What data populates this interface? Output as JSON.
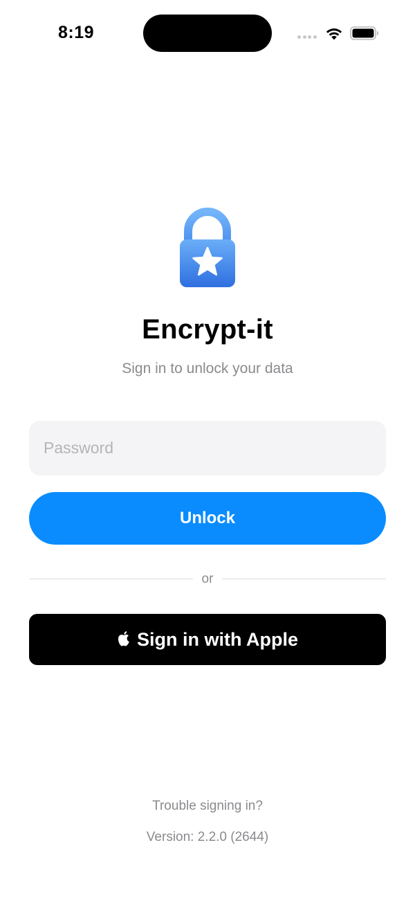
{
  "status_bar": {
    "time": "8:19"
  },
  "icons": {
    "app": "lock-star-icon",
    "signal": "cellular-signal-icon",
    "wifi": "wifi-icon",
    "battery": "battery-icon",
    "apple": "apple-logo-icon"
  },
  "colors": {
    "accent": "#0a8cff",
    "icon_top": "#6aaef8",
    "icon_bottom": "#2f6fe0",
    "field_bg": "#f4f4f6",
    "secondary_text": "#8a8a8e"
  },
  "app": {
    "title": "Encrypt-it",
    "subtitle": "Sign in to unlock your data"
  },
  "form": {
    "password_value": "",
    "password_placeholder": "Password",
    "unlock_label": "Unlock",
    "divider_label": "or",
    "apple_label": "Sign in with Apple"
  },
  "footer": {
    "trouble_label": "Trouble signing in?",
    "version": "Version: 2.2.0 (2644)"
  }
}
